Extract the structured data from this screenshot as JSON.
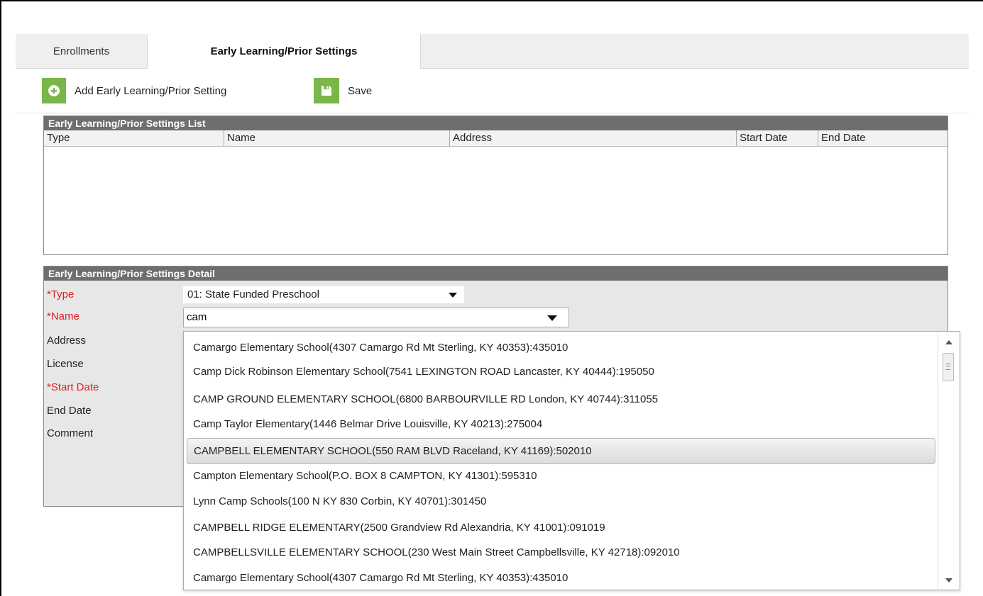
{
  "tabs": [
    {
      "label": "Enrollments"
    },
    {
      "label": "Early Learning/Prior Settings"
    }
  ],
  "toolbar": {
    "add_label": "Add Early Learning/Prior Setting",
    "save_label": "Save"
  },
  "list_panel": {
    "title": "Early Learning/Prior Settings List",
    "columns": [
      "Type",
      "Name",
      "Address",
      "Start Date",
      "End Date"
    ],
    "rows": []
  },
  "detail_panel": {
    "title": "Early Learning/Prior Settings Detail",
    "fields": {
      "type_label": "*Type",
      "name_label": "*Name",
      "address_label": "Address",
      "license_label": "License",
      "start_date_label": "*Start Date",
      "end_date_label": "End Date",
      "comment_label": "Comment"
    },
    "type_value": "01: State Funded Preschool",
    "name_value": "cam"
  },
  "dropdown": {
    "options": [
      "Camargo Elementary School(4307 Camargo Rd Mt Sterling, KY 40353):435010",
      "Camp Dick Robinson Elementary School(7541 LEXINGTON ROAD Lancaster, KY 40444):195050",
      "CAMP GROUND ELEMENTARY SCHOOL(6800 BARBOURVILLE RD London, KY 40744):311055",
      "Camp Taylor Elementary(1446 Belmar Drive Louisville, KY 40213):275004",
      "CAMPBELL ELEMENTARY SCHOOL(550 RAM BLVD Raceland, KY 41169):502010",
      "Campton Elementary School(P.O. BOX 8 CAMPTON, KY 41301):595310",
      "Lynn Camp Schools(100 N KY 830 Corbin, KY 40701):301450",
      "CAMPBELL RIDGE ELEMENTARY(2500 Grandview Rd Alexandria, KY 41001):091019",
      "CAMPBELLSVILLE ELEMENTARY SCHOOL(230 West Main Street Campbellsville, KY 42718):092010",
      "Camargo Elementary School(4307 Camargo Rd Mt Sterling, KY 40353):435010"
    ],
    "highlighted_option": "CAMPBELL ELEMENTARY SCHOOL(550 RAM BLVD Raceland, KY 41169):502010"
  },
  "colors": {
    "accent_green": "#7ab648",
    "panel_header": "#6e6e6e",
    "required_red": "#e02020"
  }
}
